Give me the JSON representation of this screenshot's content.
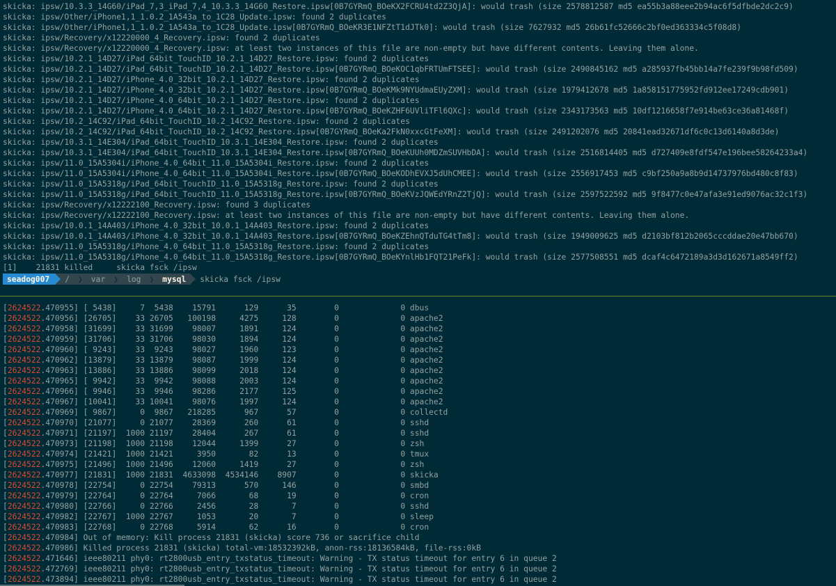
{
  "top": {
    "lines": [
      "skicka: ipsw/10.3.3_14G60/iPad_7,3_iPad_7,4_10.3.3_14G60_Restore.ipsw[0B7GYRmQ_BOeKX2FCRU4td2Z3QjA]: would trash (size 2578812587 md5 ea55b3a88eee2b94ac6f5dfbde2dc2c9)",
      "skicka: ipsw/Other/iPhone1,1_1.0.2_1A543a_to_1C28_Update.ipsw: found 2 duplicates",
      "skicka: ipsw/Other/iPhone1,1_1.0.2_1A543a_to_1C28_Update.ipsw[0B7GYRmQ_BOeKR3E1NFZtT1dJTk0]: would trash (size 7627932 md5 26b61fc52666c2bf0ed363334c5f08d8)",
      "skicka: ipsw/Recovery/x12220000_4_Recovery.ipsw: found 2 duplicates",
      "skicka: ipsw/Recovery/x12220000_4_Recovery.ipsw: at least two instances of this file are non-empty but have different contents. Leaving them alone.",
      "skicka: ipsw/10.2.1_14D27/iPad_64bit_TouchID_10.2.1_14D27_Restore.ipsw: found 2 duplicates",
      "skicka: ipsw/10.2.1_14D27/iPad_64bit_TouchID_10.2.1_14D27_Restore.ipsw[0B7GYRmQ_BOeKOC1qbFRTUmFTSEE]: would trash (size 2490845162 md5 a285937fb45bb14a7fe239f9b98fd509)",
      "skicka: ipsw/10.2.1_14D27/iPhone_4.0_32bit_10.2.1_14D27_Restore.ipsw: found 2 duplicates",
      "skicka: ipsw/10.2.1_14D27/iPhone_4.0_32bit_10.2.1_14D27_Restore.ipsw[0B7GYRmQ_BOeKMk9NYUdmaEUyZXM]: would trash (size 1979412678 md5 1a858151775952fd912ee17249cdb901)",
      "skicka: ipsw/10.2.1_14D27/iPhone_4.0_64bit_10.2.1_14D27_Restore.ipsw: found 2 duplicates",
      "skicka: ipsw/10.2.1_14D27/iPhone_4.0_64bit_10.2.1_14D27_Restore.ipsw[0B7GYRmQ_BOeKZHF6UVliTFl6QXc]: would trash (size 2343173563 md5 10df1216658f7e914be63ce36a81468f)",
      "skicka: ipsw/10.2_14C92/iPad_64bit_TouchID_10.2_14C92_Restore.ipsw: found 2 duplicates",
      "skicka: ipsw/10.2_14C92/iPad_64bit_TouchID_10.2_14C92_Restore.ipsw[0B7GYRmQ_BOeKa2FkN0xxcGtFeXM]: would trash (size 2491202076 md5 20841ead32671df6c0c13d6140a8d3de)",
      "skicka: ipsw/10.3.1_14E304/iPad_64bit_TouchID_10.3.1_14E304_Restore.ipsw: found 2 duplicates",
      "skicka: ipsw/10.3.1_14E304/iPad_64bit_TouchID_10.3.1_14E304_Restore.ipsw[0B7GYRmQ_BOeKUUh0MDZmSUVHbDA]: would trash (size 2516814405 md5 d727409e8fdf547e196bee58264233a4)",
      "skicka: ipsw/11.0_15A5304i/iPhone_4.0_64bit_11.0_15A5304i_Restore.ipsw: found 2 duplicates",
      "skicka: ipsw/11.0_15A5304i/iPhone_4.0_64bit_11.0_15A5304i_Restore.ipsw[0B7GYRmQ_BOeKODhEVXJ5dUhCMEE]: would trash (size 2556917453 md5 c9bf250a9a8b9d14737976bd480c8f83)",
      "skicka: ipsw/11.0_15A5318g/iPad_64bit_TouchID_11.0_15A5318g_Restore.ipsw: found 2 duplicates",
      "skicka: ipsw/11.0_15A5318g/iPad_64bit_TouchID_11.0_15A5318g_Restore.ipsw[0B7GYRmQ_BOeKVzJQWEdYRnZ2TjQ]: would trash (size 2597522592 md5 9f8477c0e47afa3e91ed9076ac32c1f3)",
      "skicka: ipsw/Recovery/x12222100_Recovery.ipsw: found 3 duplicates",
      "skicka: ipsw/Recovery/x12222100_Recovery.ipsw: at least two instances of this file are non-empty but have different contents. Leaving them alone.",
      "skicka: ipsw/10.0.1_14A403/iPhone_4.0_32bit_10.0.1_14A403_Restore.ipsw: found 2 duplicates",
      "skicka: ipsw/10.0.1_14A403/iPhone_4.0_32bit_10.0.1_14A403_Restore.ipsw[0B7GYRmQ_BOeKZEhnQTduTG4tTm8]: would trash (size 1949009625 md5 d2103bf812b2065cccddae20e47bb670)",
      "skicka: ipsw/11.0_15A5318g/iPhone_4.0_64bit_11.0_15A5318g_Restore.ipsw: found 2 duplicates",
      "skicka: ipsw/11.0_15A5318g/iPhone_4.0_64bit_11.0_15A5318g_Restore.ipsw[0B7GYRmQ_BOeKYnlHb1FQT21PeFk]: would trash (size 2577508551 md5 dcaf4c6472189a3d3d162671a8549ff2)",
      "[1]    21831 killed     skicka fsck /ipsw"
    ]
  },
  "prompt": {
    "host": "seadog007",
    "path": [
      "/",
      "var",
      "log"
    ],
    "current_dir": "mysql",
    "command": "skicka fsck /ipsw"
  },
  "bottom": {
    "lines": [
      {
        "ts": "2624522",
        "rest": ".470955] [ 5438]     7  5438    15791      129      35        0             0 dbus"
      },
      {
        "ts": "2624522",
        "rest": ".470956] [26705]    33 26705   100198     4275     128        0             0 apache2"
      },
      {
        "ts": "2624522",
        "rest": ".470958] [31699]    33 31699    98007     1891     124        0             0 apache2"
      },
      {
        "ts": "2624522",
        "rest": ".470959] [31706]    33 31706    98030     1894     124        0             0 apache2"
      },
      {
        "ts": "2624522",
        "rest": ".470960] [ 9243]    33  9243    98027     1960     123        0             0 apache2"
      },
      {
        "ts": "2624522",
        "rest": ".470962] [13879]    33 13879    98087     1999     124        0             0 apache2"
      },
      {
        "ts": "2624522",
        "rest": ".470963] [13886]    33 13886    98099     2018     124        0             0 apache2"
      },
      {
        "ts": "2624522",
        "rest": ".470965] [ 9942]    33  9942    98088     2003     124        0             0 apache2"
      },
      {
        "ts": "2624522",
        "rest": ".470966] [ 9946]    33  9946    98286     2177     125        0             0 apache2"
      },
      {
        "ts": "2624522",
        "rest": ".470967] [10041]    33 10041    98076     1997     124        0             0 apache2"
      },
      {
        "ts": "2624522",
        "rest": ".470969] [ 9867]     0  9867   218285      967      57        0             0 collectd"
      },
      {
        "ts": "2624522",
        "rest": ".470970] [21077]     0 21077    28369      260      61        0             0 sshd"
      },
      {
        "ts": "2624522",
        "rest": ".470971] [21197]  1000 21197    28404      267      61        0             0 sshd"
      },
      {
        "ts": "2624522",
        "rest": ".470973] [21198]  1000 21198    12044     1399      27        0             0 zsh"
      },
      {
        "ts": "2624522",
        "rest": ".470974] [21421]  1000 21421     3950       82      13        0             0 tmux"
      },
      {
        "ts": "2624522",
        "rest": ".470975] [21496]  1000 21496    12060     1419      27        0             0 zsh"
      },
      {
        "ts": "2624522",
        "rest": ".470977] [21831]  1000 21831  4633098  4534146    8907        0             0 skicka"
      },
      {
        "ts": "2624522",
        "rest": ".470978] [22754]     0 22754    79313      570     146        0             0 smbd"
      },
      {
        "ts": "2624522",
        "rest": ".470979] [22764]     0 22764     7066       68      19        0             0 cron"
      },
      {
        "ts": "2624522",
        "rest": ".470980] [22766]     0 22766     2456       28       7        0             0 sshd"
      },
      {
        "ts": "2624522",
        "rest": ".470982] [22767]  1000 22767     1053       20       7        0             0 sleep"
      },
      {
        "ts": "2624522",
        "rest": ".470983] [22768]     0 22768     5914       62      16        0             0 cron"
      },
      {
        "ts": "2624522",
        "rest": ".470984] Out of memory: Kill process 21831 (skicka) score 736 or sacrifice child"
      },
      {
        "ts": "2624522",
        "rest": ".470986] Killed process 21831 (skicka) total-vm:18532392kB, anon-rss:18136584kB, file-rss:0kB"
      },
      {
        "ts": "2624522",
        "rest": ".471646] ieee80211 phy0: rt2800usb_entry_txstatus_timeout: Warning - TX status timeout for entry 6 in queue 2"
      },
      {
        "ts": "2624522",
        "rest": ".472769] ieee80211 phy0: rt2800usb_entry_txstatus_timeout: Warning - TX status timeout for entry 6 in queue 2"
      },
      {
        "ts": "2624522",
        "rest": ".473894] ieee80211 phy0: rt2800usb_entry_txstatus_timeout: Warning - TX status timeout for entry 6 in queue 2"
      }
    ]
  },
  "colors": {
    "background": "#002b36",
    "text": "#93a1a1",
    "timestamp": "#dc4a2f",
    "host_segment": "#268bd2",
    "path_segment": "#33454d",
    "divider": "#5f8a1f"
  }
}
